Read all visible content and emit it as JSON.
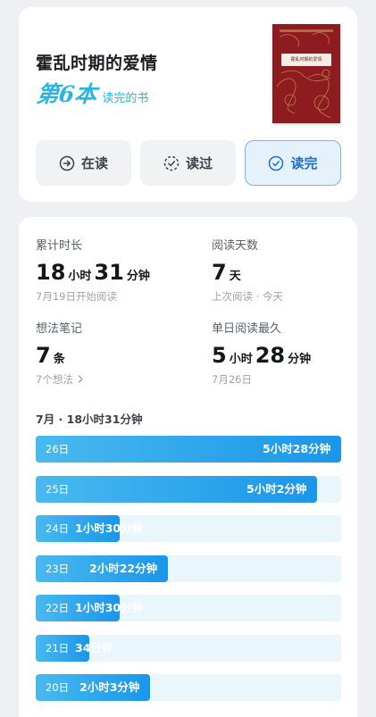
{
  "book": {
    "title": "霍乱时期的爱情",
    "rank_big": "第6本",
    "rank_small": "读完的书",
    "cover_title": "霍乱时期的爱情"
  },
  "status_buttons": {
    "reading": "在读",
    "read": "读过",
    "finished": "读完"
  },
  "stats": {
    "total_time": {
      "label": "累计时长",
      "hours": "18",
      "hours_unit": "小时",
      "minutes": "31",
      "minutes_unit": "分钟",
      "sub": "7月19日开始阅读"
    },
    "days": {
      "label": "阅读天数",
      "value": "7",
      "unit": "天",
      "sub": "上次阅读 · 今天"
    },
    "notes": {
      "label": "想法笔记",
      "value": "7",
      "unit": "条",
      "sub": "7个想法"
    },
    "longest": {
      "label": "单日阅读最久",
      "hours": "5",
      "hours_unit": "小时",
      "minutes": "28",
      "minutes_unit": "分钟",
      "sub": "7月26日"
    }
  },
  "month_summary": "7月 · 18小时31分钟",
  "daily": [
    {
      "day": "26日",
      "label": "5小时28分钟",
      "minutes": 328
    },
    {
      "day": "25日",
      "label": "5小时2分钟",
      "minutes": 302
    },
    {
      "day": "24日",
      "label": "1小时30分钟",
      "minutes": 90
    },
    {
      "day": "23日",
      "label": "2小时22分钟",
      "minutes": 142
    },
    {
      "day": "22日",
      "label": "1小时30分钟",
      "minutes": 90
    },
    {
      "day": "21日",
      "label": "34分钟",
      "minutes": 34
    },
    {
      "day": "20日",
      "label": "2小时3分钟",
      "minutes": 123
    }
  ],
  "colors": {
    "accent": "#1a96ea",
    "rank": "#2ab3e3",
    "cover": "#8d1b1f"
  }
}
